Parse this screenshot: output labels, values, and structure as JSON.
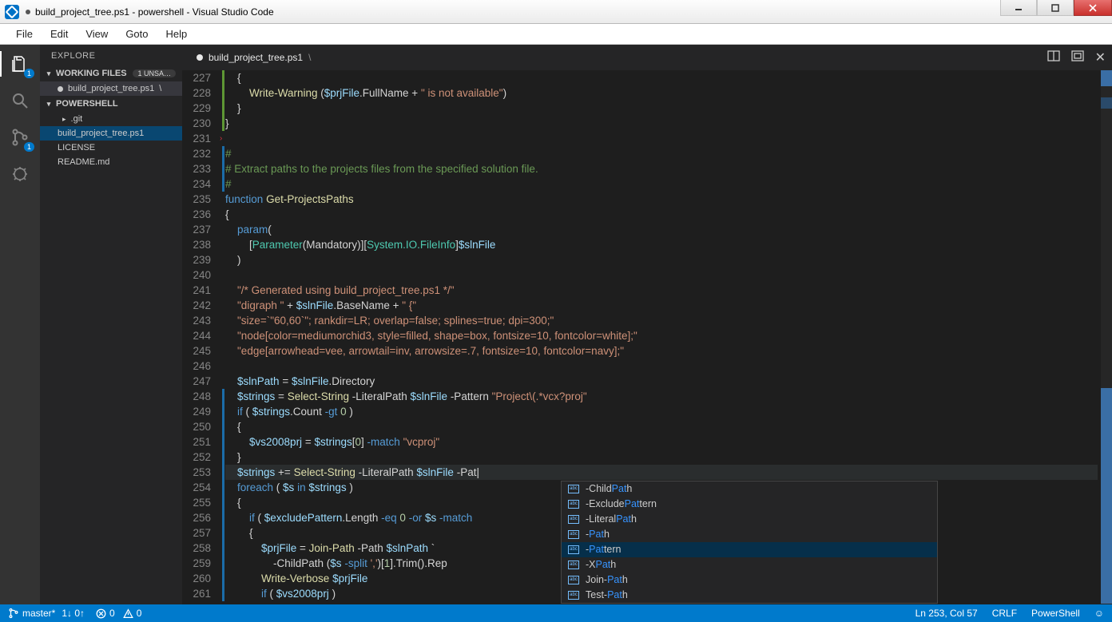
{
  "window": {
    "title": "build_project_tree.ps1 - powershell - Visual Studio Code"
  },
  "menubar": [
    "File",
    "Edit",
    "View",
    "Goto",
    "Help"
  ],
  "activity": {
    "explorer_badge": "1",
    "git_badge": "1"
  },
  "sidebar": {
    "title": "EXPLORE",
    "working_section": "WORKING FILES",
    "working_badge": "1 UNSA…",
    "folder_section": "POWERSHELL",
    "working_files": [
      {
        "name": "build_project_tree.ps1",
        "dirty": true,
        "trunc": " \\"
      }
    ],
    "folders": [
      {
        "name": ".git",
        "type": "folder",
        "indent": true
      },
      {
        "name": "build_project_tree.ps1",
        "type": "file",
        "selected": true
      },
      {
        "name": "LICENSE",
        "type": "file"
      },
      {
        "name": "README.md",
        "type": "file"
      }
    ]
  },
  "tab": {
    "name": "build_project_tree.ps1",
    "trunc": " \\"
  },
  "code": {
    "start": 227,
    "lines": [
      {
        "n": 227,
        "g": "green",
        "html": "    {"
      },
      {
        "n": 228,
        "g": "green",
        "html": "        <span class='fn'>Write-Warning</span> (<span class='var'>$prjFile</span>.FullName + <span class='str'>\" is not available\"</span>)"
      },
      {
        "n": 229,
        "g": "green",
        "html": "    }"
      },
      {
        "n": 230,
        "g": "green",
        "html": "}"
      },
      {
        "n": 231,
        "g": "red",
        "html": ""
      },
      {
        "n": 232,
        "g": "blue",
        "html": "<span class='cmt'>#</span>"
      },
      {
        "n": 233,
        "g": "blue",
        "html": "<span class='cmt'># Extract paths to the projects files from the specified solution file.</span>"
      },
      {
        "n": 234,
        "g": "blue",
        "html": "<span class='cmt'>#</span>"
      },
      {
        "n": 235,
        "g": "",
        "html": "<span class='kw'>function</span> <span class='fn'>Get-ProjectsPaths</span>"
      },
      {
        "n": 236,
        "g": "",
        "html": "{"
      },
      {
        "n": 237,
        "g": "",
        "html": "    <span class='kw'>param</span>("
      },
      {
        "n": 238,
        "g": "",
        "html": "        [<span class='type'>Parameter</span>(Mandatory)][<span class='type'>System.IO.FileInfo</span>]<span class='var'>$slnFile</span>"
      },
      {
        "n": 239,
        "g": "",
        "html": "    )"
      },
      {
        "n": 240,
        "g": "",
        "html": ""
      },
      {
        "n": 241,
        "g": "",
        "html": "    <span class='str'>\"/* Generated using build_project_tree.ps1 */\"</span>"
      },
      {
        "n": 242,
        "g": "",
        "html": "    <span class='str'>\"digraph \"</span> + <span class='var'>$slnFile</span>.BaseName + <span class='str'>\" {\"</span>"
      },
      {
        "n": 243,
        "g": "",
        "html": "    <span class='str'>\"size=`\"60,60`\"; rankdir=LR; overlap=false; splines=true; dpi=300;\"</span>"
      },
      {
        "n": 244,
        "g": "",
        "html": "    <span class='str'>\"node[color=mediumorchid3, style=filled, shape=box, fontsize=10, fontcolor=white];\"</span>"
      },
      {
        "n": 245,
        "g": "",
        "html": "    <span class='str'>\"edge[arrowhead=vee, arrowtail=inv, arrowsize=.7, fontsize=10, fontcolor=navy];\"</span>"
      },
      {
        "n": 246,
        "g": "",
        "html": ""
      },
      {
        "n": 247,
        "g": "",
        "html": "    <span class='var'>$slnPath</span> = <span class='var'>$slnFile</span>.Directory"
      },
      {
        "n": 248,
        "g": "blue",
        "html": "    <span class='var'>$strings</span> = <span class='fn'>Select-String</span> -LiteralPath <span class='var'>$slnFile</span> -Pattern <span class='str'>\"Project\\(.*vcx?proj\"</span>"
      },
      {
        "n": 249,
        "g": "blue",
        "html": "    <span class='kw'>if</span> ( <span class='var'>$strings</span>.Count <span class='kw'>-gt</span> <span class='num'>0</span> )"
      },
      {
        "n": 250,
        "g": "blue",
        "html": "    {"
      },
      {
        "n": 251,
        "g": "blue",
        "html": "        <span class='var'>$vs2008prj</span> = <span class='var'>$strings</span>[<span class='num'>0</span>] <span class='kw'>-match</span> <span class='str'>\"vcproj\"</span>"
      },
      {
        "n": 252,
        "g": "blue",
        "html": "    }"
      },
      {
        "n": 253,
        "g": "blue",
        "hl": true,
        "html": "    <span class='var'>$strings</span> += <span class='fn'>Select-String</span> -LiteralPath <span class='var'>$slnFile</span> -Pat|"
      },
      {
        "n": 254,
        "g": "blue",
        "html": "    <span class='kw'>foreach</span> ( <span class='var'>$s</span> <span class='kw'>in</span> <span class='var'>$strings</span> )"
      },
      {
        "n": 255,
        "g": "blue",
        "html": "    {"
      },
      {
        "n": 256,
        "g": "blue",
        "html": "        <span class='kw'>if</span> ( <span class='var'>$excludePattern</span>.Length <span class='kw'>-eq</span> <span class='num'>0</span> <span class='kw'>-or</span> <span class='var'>$s</span> <span class='kw'>-match</span>"
      },
      {
        "n": 257,
        "g": "blue",
        "html": "        {"
      },
      {
        "n": 258,
        "g": "blue",
        "html": "            <span class='var'>$prjFile</span> = <span class='fn'>Join-Path</span> -Path <span class='var'>$slnPath</span> `"
      },
      {
        "n": 259,
        "g": "blue",
        "html": "                -ChildPath (<span class='var'>$s</span> <span class='kw'>-split</span> <span class='str'>','</span>)[<span class='num'>1</span>].Trim().Rep"
      },
      {
        "n": 260,
        "g": "blue",
        "html": "            <span class='fn'>Write-Verbose</span> <span class='var'>$prjFile</span>"
      },
      {
        "n": 261,
        "g": "blue",
        "html": "            <span class='kw'>if</span> ( <span class='var'>$vs2008prj</span> )"
      }
    ]
  },
  "intellisense": {
    "items": [
      {
        "pre": "-Child",
        "match": "Pat",
        "post": "h"
      },
      {
        "pre": "-Exclude",
        "match": "Pat",
        "post": "tern"
      },
      {
        "pre": "-Literal",
        "match": "Pat",
        "post": "h"
      },
      {
        "pre": "-",
        "match": "Pat",
        "post": "h"
      },
      {
        "pre": "-",
        "match": "Pat",
        "post": "tern",
        "selected": true
      },
      {
        "pre": "-X",
        "match": "Pat",
        "post": "h"
      },
      {
        "pre": "Join-",
        "match": "Pat",
        "post": "h"
      },
      {
        "pre": "Test-",
        "match": "Pat",
        "post": "h"
      }
    ]
  },
  "status": {
    "branch": "master*",
    "sync": "1↓ 0↑",
    "errors": "0",
    "warnings": "0",
    "line_col": "Ln 253, Col 57",
    "eol": "CRLF",
    "lang": "PowerShell"
  }
}
